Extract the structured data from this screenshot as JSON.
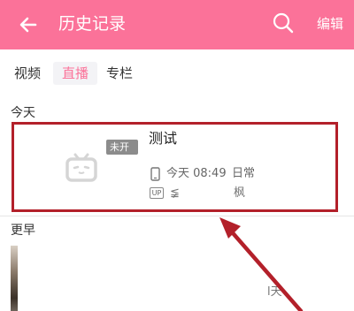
{
  "header": {
    "title": "历史记录",
    "edit_label": "编辑",
    "accent_color": "#fb7299"
  },
  "tabs": [
    {
      "label": "视频",
      "active": false
    },
    {
      "label": "直播",
      "active": true
    },
    {
      "label": "专栏",
      "active": false
    }
  ],
  "sections": {
    "today_label": "今天",
    "earlier_label": "更早"
  },
  "today_record": {
    "status": "未开播",
    "title": "测试",
    "time": "今天 08:49",
    "category": "日常",
    "uploader_prefix": "≨",
    "uploader_suffix": "枫",
    "device_icon": "phone-icon",
    "up_icon_text": "UP",
    "thumb_icon": "tv-icon"
  },
  "earlier_record": {
    "time_fragment": "l天"
  },
  "annotation": {
    "highlight_color": "#b3202a"
  }
}
